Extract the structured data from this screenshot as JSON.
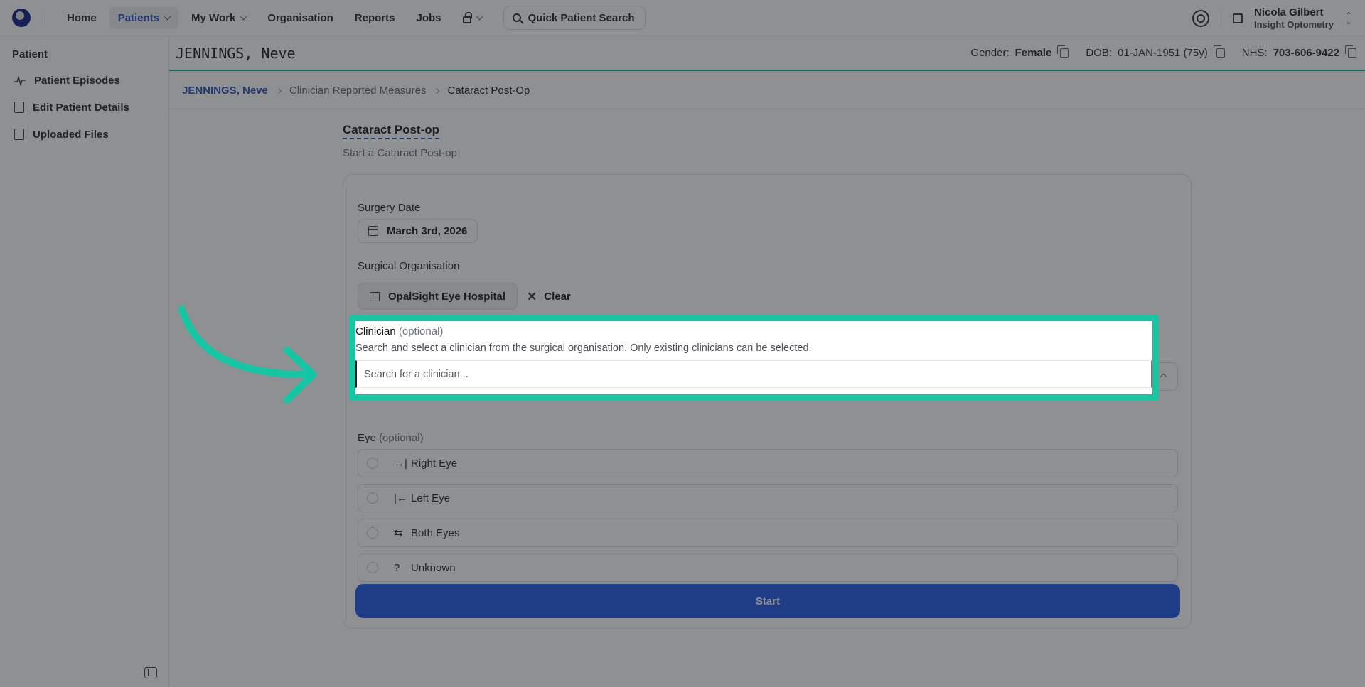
{
  "nav": {
    "items": [
      {
        "label": "Home",
        "active": false,
        "chevron": false
      },
      {
        "label": "Patients",
        "active": true,
        "chevron": true
      },
      {
        "label": "My Work",
        "active": false,
        "chevron": true
      },
      {
        "label": "Organisation",
        "active": false,
        "chevron": false
      },
      {
        "label": "Reports",
        "active": false,
        "chevron": false
      },
      {
        "label": "Jobs",
        "active": false,
        "chevron": false
      }
    ],
    "quick_search_label": "Quick Patient Search",
    "user_name": "Nicola Gilbert",
    "user_org": "Insight Optometry"
  },
  "sidebar": {
    "title": "Patient",
    "items": [
      {
        "label": "Patient Episodes",
        "icon": "pulse-icon"
      },
      {
        "label": "Edit Patient Details",
        "icon": "id-card-icon"
      },
      {
        "label": "Uploaded Files",
        "icon": "files-icon"
      }
    ]
  },
  "patient": {
    "name": "JENNINGS, Neve",
    "gender_label": "Gender:",
    "gender": "Female",
    "dob_label": "DOB:",
    "dob": "01-JAN-1951 (75y)",
    "nhs_label": "NHS:",
    "nhs": "703-606-9422"
  },
  "breadcrumb": {
    "patient": "JENNINGS, Neve",
    "section": "Clinician Reported Measures",
    "current": "Cataract Post-Op"
  },
  "form": {
    "title": "Cataract Post-op",
    "subtitle": "Start a Cataract Post-op",
    "surgery_date_label": "Surgery Date",
    "surgery_date": "March 3rd, 2026",
    "surgical_org_label": "Surgical Organisation",
    "surgical_org": "OpalSight Eye Hospital",
    "clear_label": "Clear",
    "clinician_label": "Clinician",
    "clinician_optional": "(optional)",
    "clinician_desc": "Search and select a clinician from the surgical organisation. Only existing clinicians can be selected.",
    "clinician_placeholder": "Search for a clinician...",
    "eye_label": "Eye",
    "eye_optional": "(optional)",
    "eye_options": [
      {
        "label": "Right Eye",
        "glyph": "→|"
      },
      {
        "label": "Left Eye",
        "glyph": "|←"
      },
      {
        "label": "Both Eyes",
        "glyph": "⇆"
      },
      {
        "label": "Unknown",
        "glyph": "?"
      }
    ],
    "start_label": "Start"
  },
  "colors": {
    "accent": "#2c5bc4",
    "highlight": "#13c7a4",
    "primary_button": "#2a5ee8"
  }
}
